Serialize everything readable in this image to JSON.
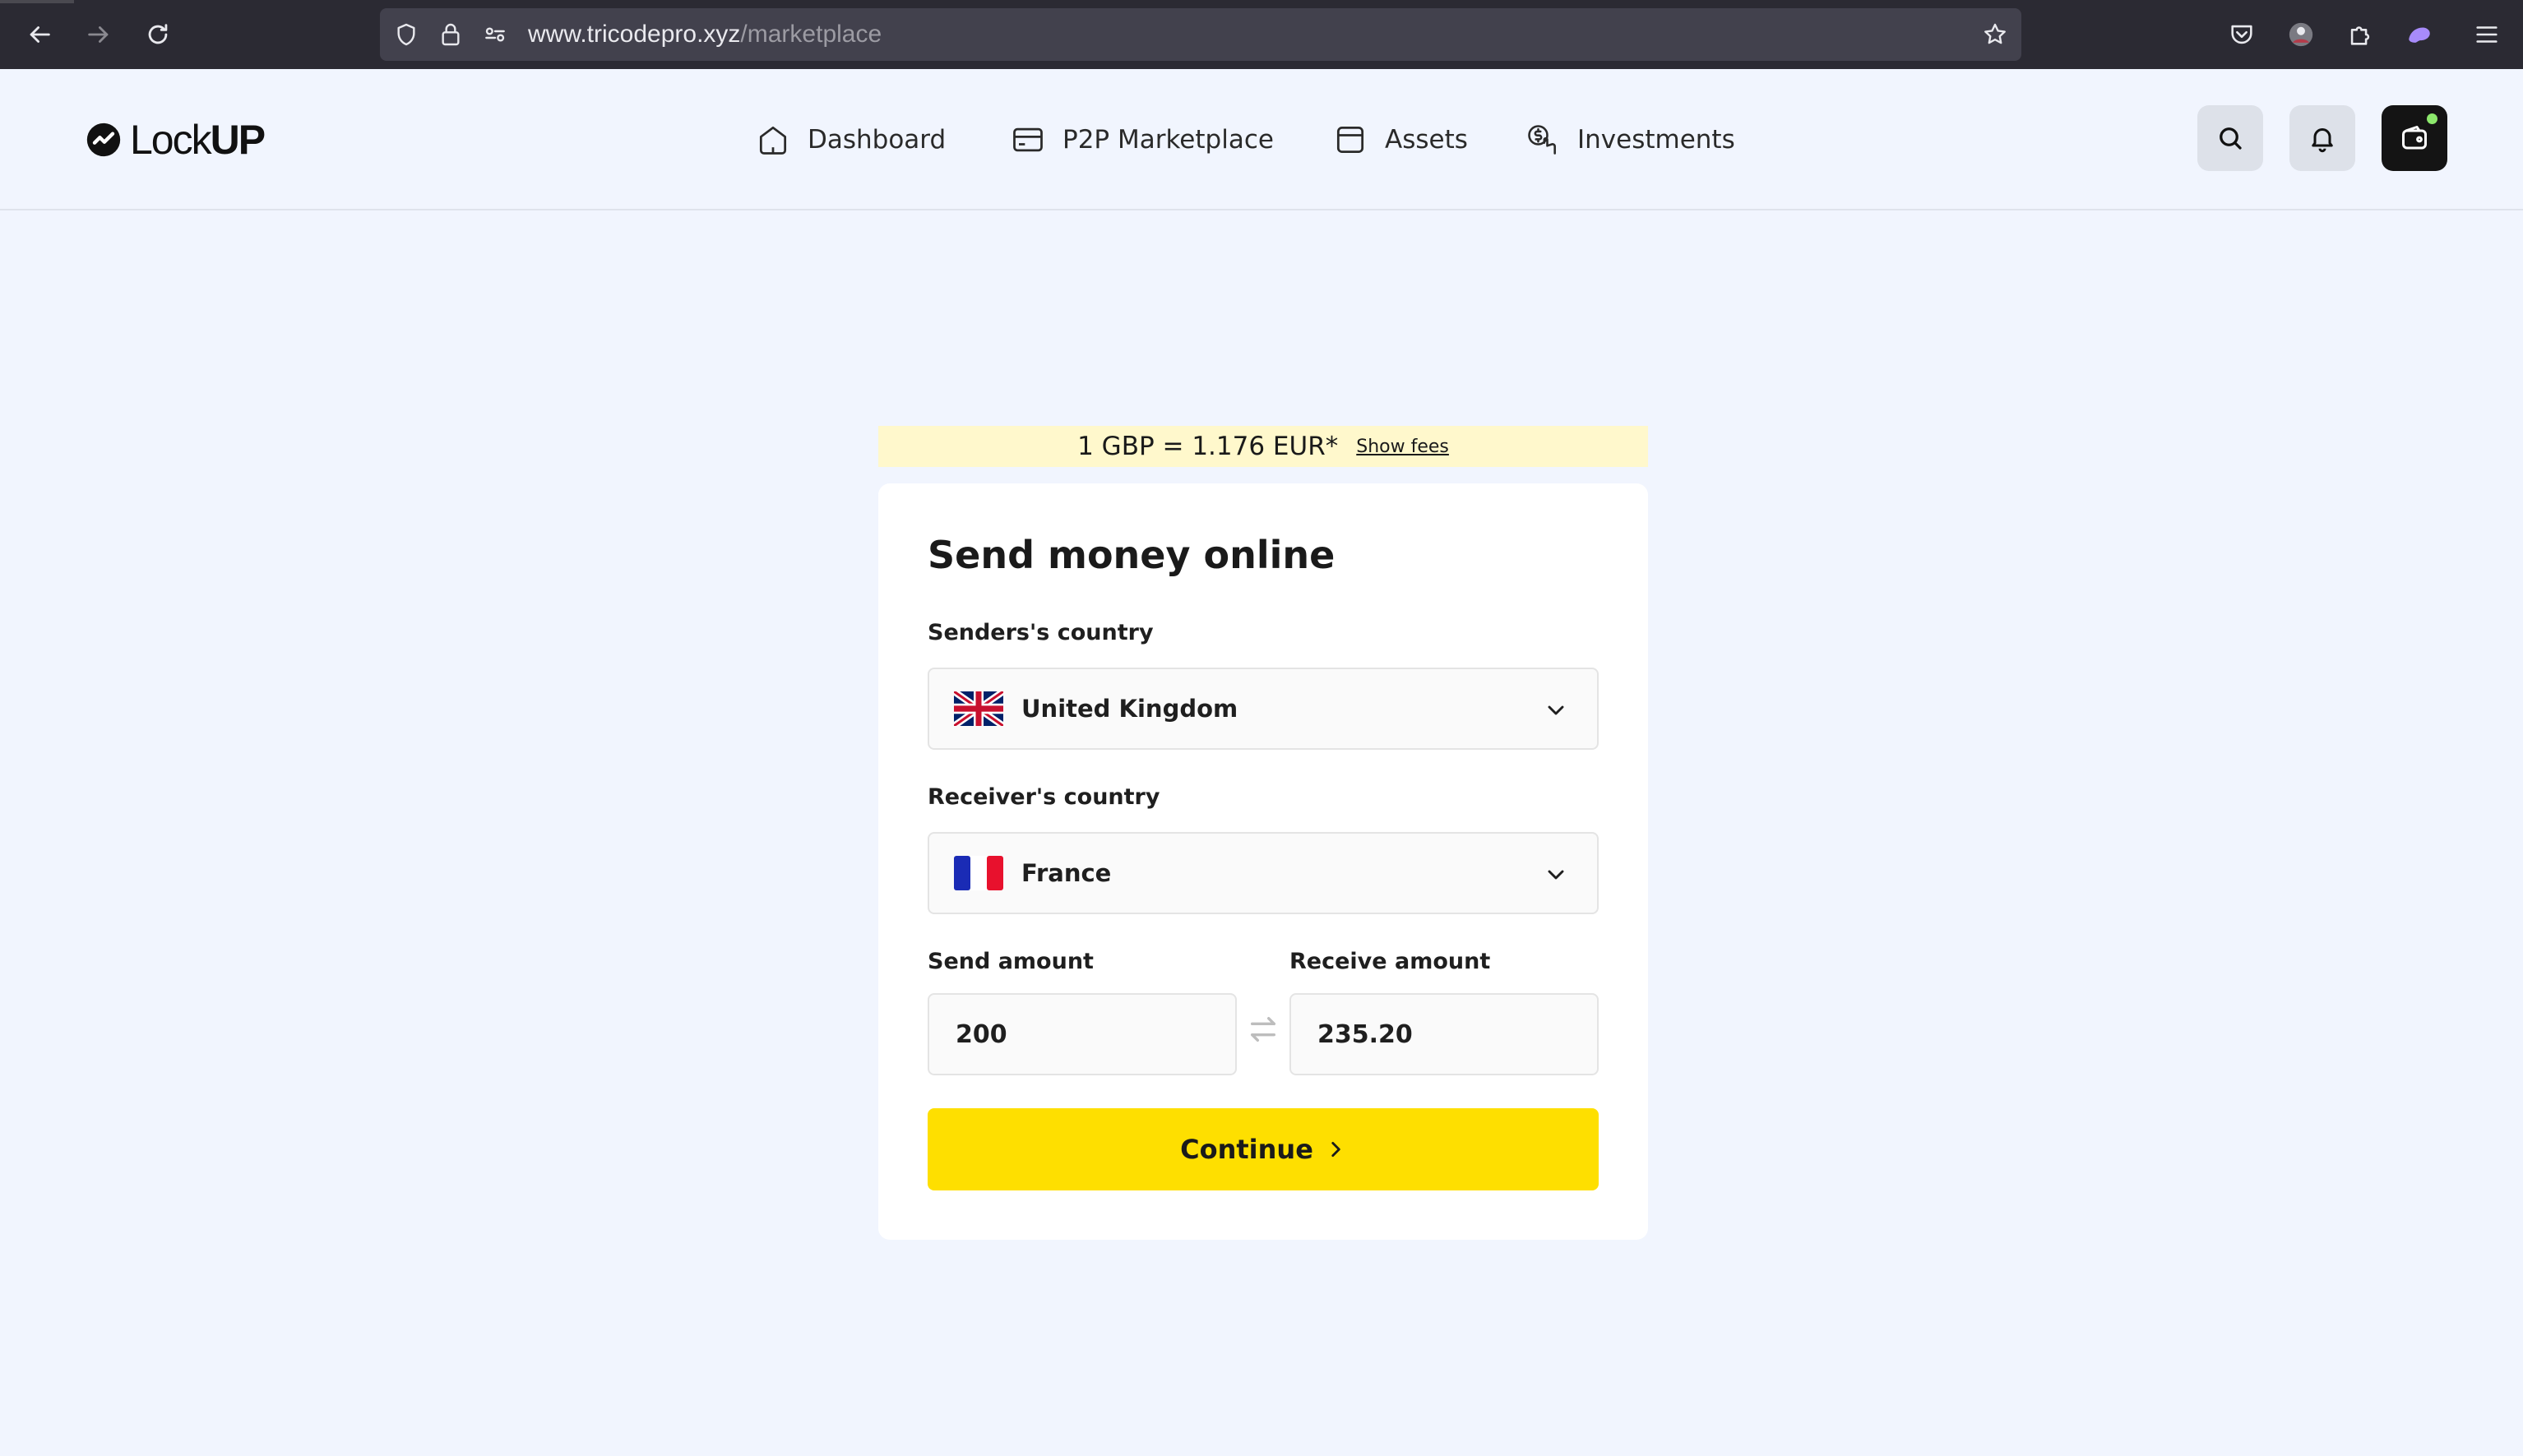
{
  "browser": {
    "url_host": "www.tricodepro.xyz",
    "url_path": "/marketplace"
  },
  "app": {
    "logo_light": "Lock",
    "logo_bold": "UP"
  },
  "nav": {
    "items": [
      {
        "label": "Dashboard",
        "icon": "home-icon"
      },
      {
        "label": "P2P Marketplace",
        "icon": "card-icon"
      },
      {
        "label": "Assets",
        "icon": "assets-icon"
      },
      {
        "label": "Investments",
        "icon": "investments-icon"
      }
    ]
  },
  "header_actions": [
    "search-icon",
    "bell-icon",
    "wallet-icon"
  ],
  "rate": {
    "text": "1 GBP = 1.176 EUR*",
    "show_fees": "Show fees"
  },
  "form": {
    "title": "Send money online",
    "sender_label": "Senders's country",
    "sender_value": "United Kingdom",
    "receiver_label": "Receiver's country",
    "receiver_value": "France",
    "send_label": "Send amount",
    "send_value": "200",
    "receive_label": "Receive amount",
    "receive_value": "235.20",
    "continue_label": "Continue"
  },
  "colors": {
    "accent": "#fedf00",
    "banner": "#fff8cc",
    "page_bg": "#f1f5fe",
    "chrome_bg": "#2b2a33"
  }
}
